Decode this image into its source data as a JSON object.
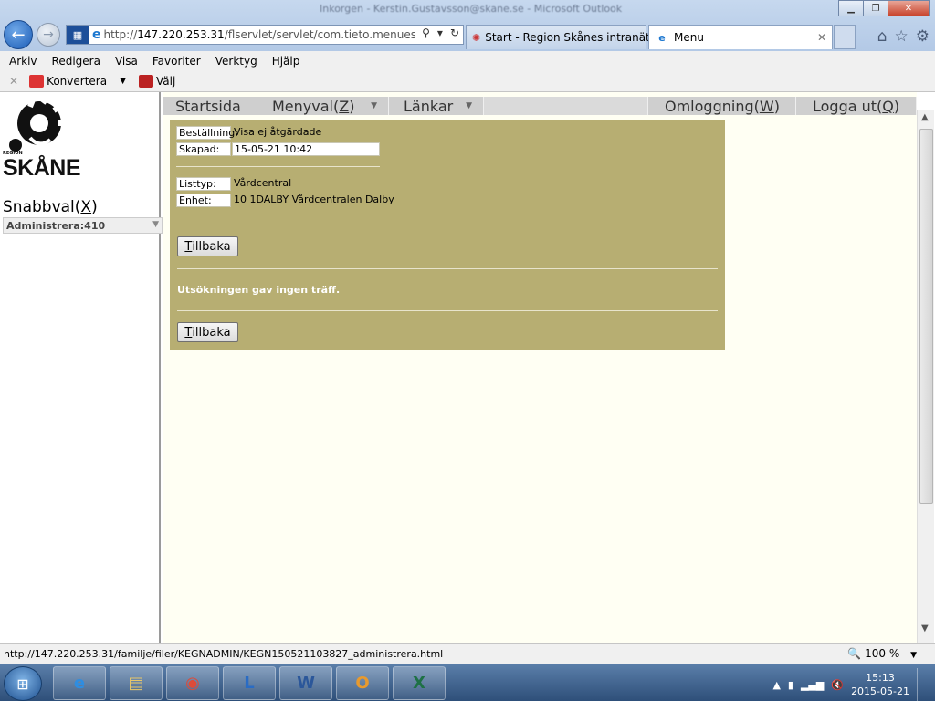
{
  "browser": {
    "window_title": "Inkorgen - Kerstin.Gustavsson@skane.se - Microsoft Outlook",
    "address_url_prefix": "http://",
    "address_url_host": "147.220.253.31",
    "address_url_path": "/flservlet/servlet/com.tieto.menues.ALMe",
    "tabs": [
      {
        "label": "Start - Region Skånes intranät"
      },
      {
        "label": "Menu"
      }
    ]
  },
  "menubar": [
    "Arkiv",
    "Redigera",
    "Visa",
    "Favoriter",
    "Verktyg",
    "Hjälp"
  ],
  "commandbar": {
    "konvertera": "Konvertera",
    "valj": "Välj"
  },
  "sidebar": {
    "logo_region": "REGION",
    "logo_word": "SKÅNE",
    "snabbval_label": "Snabbval(",
    "snabbval_key": "X",
    "snabbval_end": ")",
    "select_value": "Administrera:410"
  },
  "topnav": {
    "startsida": "Startsida",
    "menyval": "Menyval(",
    "menyval_key": "Z",
    "menyval_end": ")",
    "lankar": "Länkar",
    "omloggning": "Omloggning(",
    "omloggning_key": "W",
    "omloggning_end": ")",
    "loggaut": "Logga ut(",
    "loggaut_key": "Q",
    "loggaut_end": ")"
  },
  "panel": {
    "bestallning_label": "Beställning:",
    "bestallning_value": "Visa ej åtgärdade",
    "skapad_label": "Skapad:",
    "skapad_value": "15-05-21 10:42",
    "listtyp_label": "Listtyp:",
    "listtyp_value": "Vårdcentral",
    "enhet_label": "Enhet:",
    "enhet_value": "10 1DALBY Vårdcentralen Dalby",
    "back_key": "T",
    "back_rest": "illbaka",
    "message": "Utsökningen gav ingen träff."
  },
  "statusbar": {
    "url": "http://147.220.253.31/familje/filer/KEGNADMIN/KEGN150521103827_administrera.html",
    "zoom": "100 %"
  },
  "taskbar": {
    "time": "15:13",
    "date": "2015-05-21"
  }
}
